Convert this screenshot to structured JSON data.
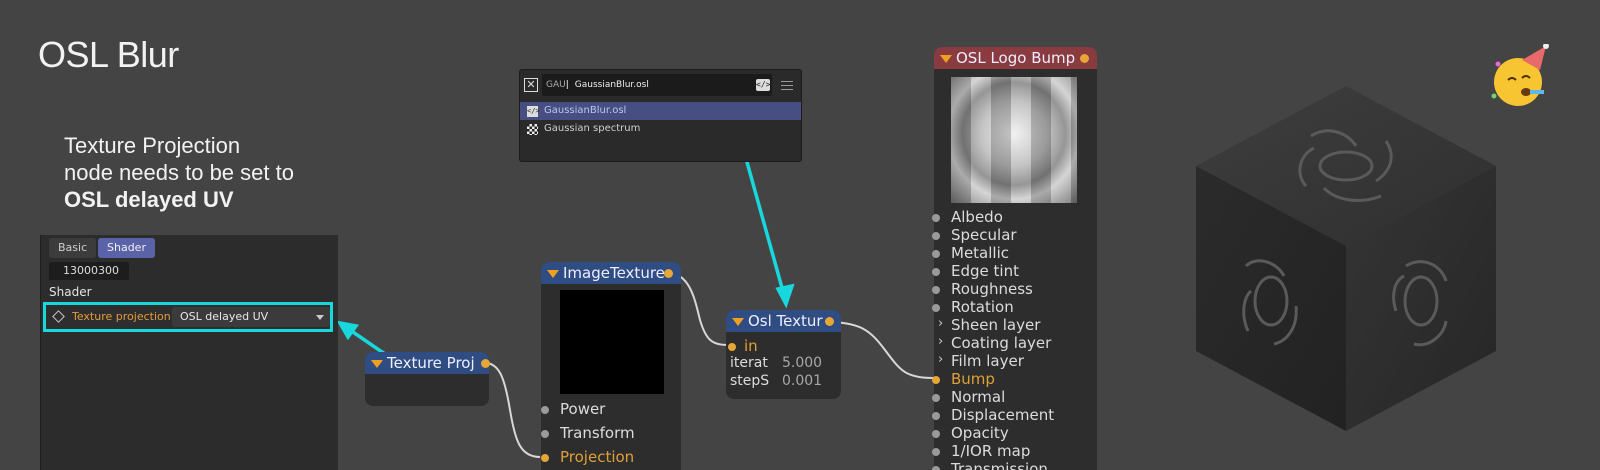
{
  "title": "OSL Blur",
  "note": {
    "line1": "Texture Projection",
    "line2": "node needs to be  set to",
    "bold": "OSL delayed UV"
  },
  "inspector": {
    "tabs": [
      "Basic",
      "Shader"
    ],
    "active_tab": "Shader",
    "id_value": "13000300",
    "section": "Shader",
    "param_label": "Texture projection",
    "param_value": "OSL delayed UV"
  },
  "popup": {
    "search_prefix": "GAU",
    "search_value": "GaussianBlur.osl",
    "items": [
      "GaussianBlur.osl",
      "Gaussian spectrum"
    ],
    "selected_index": 0
  },
  "nodes": {
    "texture_projection": {
      "title": "Texture Proj"
    },
    "image_texture": {
      "title": "ImageTexture",
      "inputs": [
        "Power",
        "Transform",
        "Projection"
      ]
    },
    "osl_texture": {
      "title": "Osl Textur",
      "inputs": [
        "in",
        "iterat",
        "stepS"
      ],
      "values": [
        "5.000",
        "0.001"
      ]
    },
    "osl_logo_bump": {
      "title": "OSL Logo Bump",
      "inputs": [
        "Albedo",
        "Specular",
        "Metallic",
        "Edge tint",
        "Roughness",
        "Rotation",
        "Sheen layer",
        "Coating layer",
        "Film layer",
        "Bump",
        "Normal",
        "Displacement",
        "Opacity",
        "1/IOR map",
        "Transmission"
      ]
    }
  },
  "colors": {
    "highlight": "#18d8dd",
    "socket_active": "#e8a636",
    "node_header_blue": "#2f4d82",
    "node_header_red": "#8a3b3f",
    "tab_active": "#5a63a8"
  }
}
